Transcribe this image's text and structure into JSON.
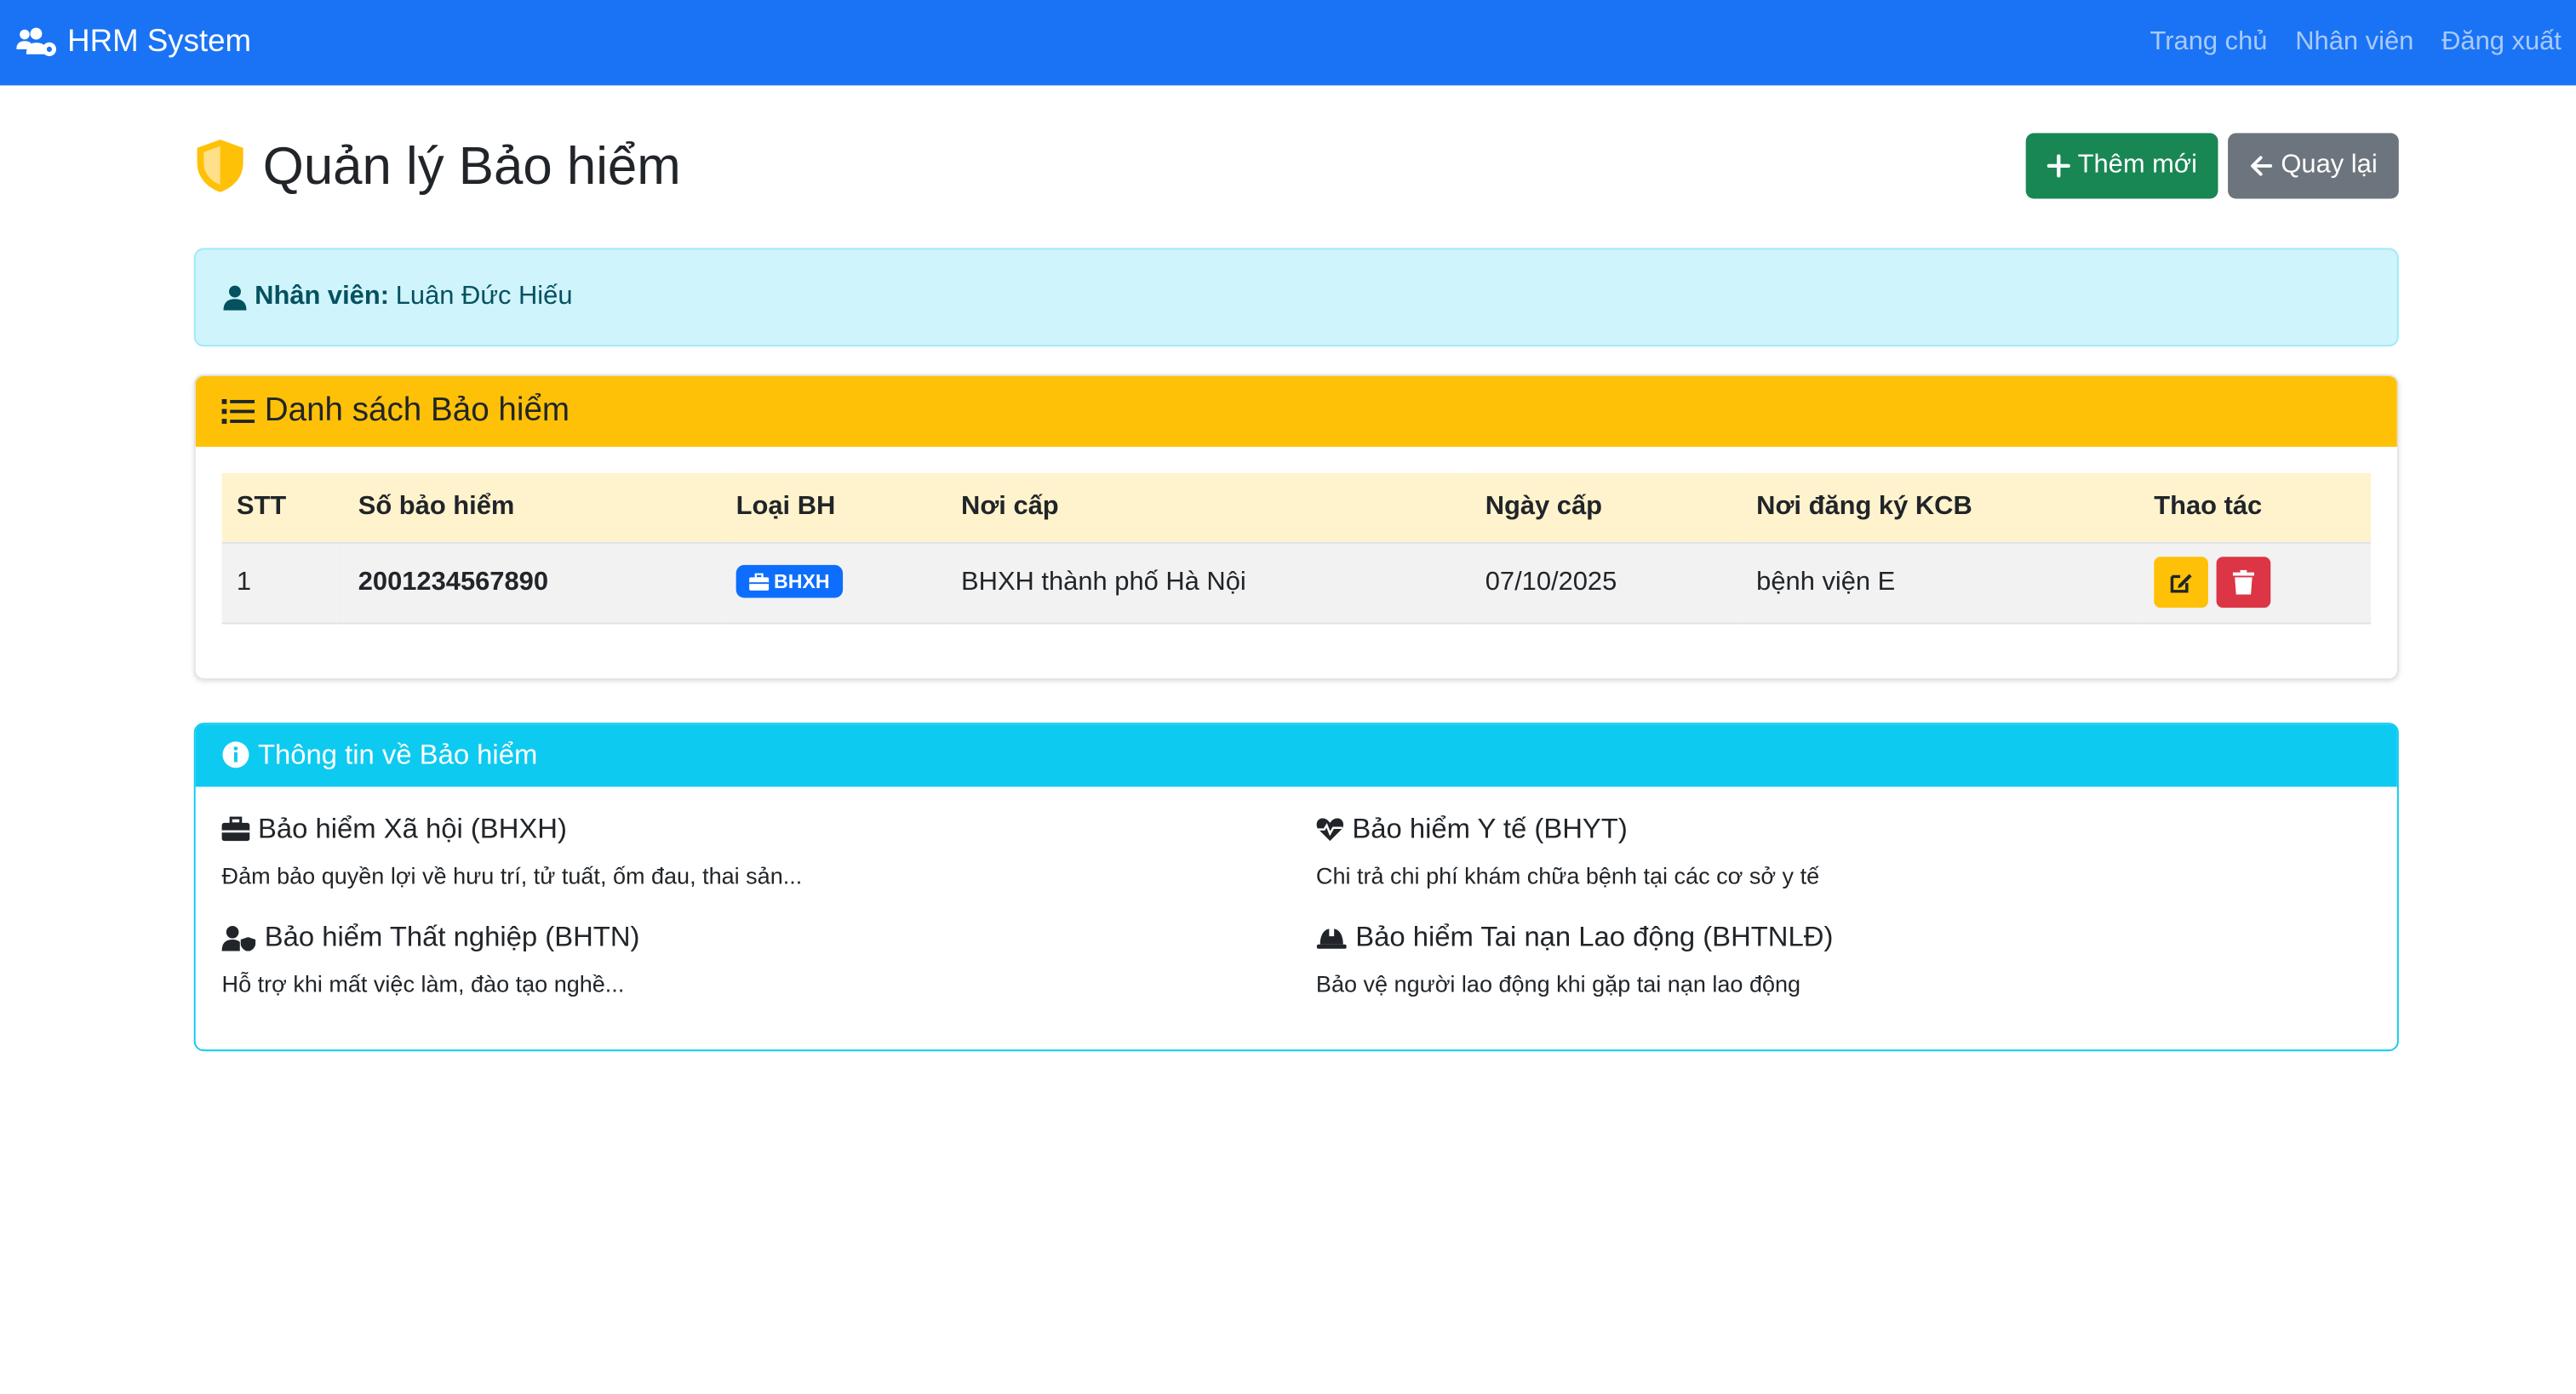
{
  "navbar": {
    "brand": "HRM System",
    "links": [
      "Trang chủ",
      "Nhân viên",
      "Đăng xuất"
    ]
  },
  "header": {
    "title": "Quản lý Bảo hiểm",
    "add_button": "Thêm mới",
    "back_button": "Quay lại"
  },
  "employee": {
    "label": "Nhân viên:",
    "name": "Luân Đức Hiếu"
  },
  "insurance_list": {
    "title": "Danh sách Bảo hiểm",
    "columns": [
      "STT",
      "Số bảo hiểm",
      "Loại BH",
      "Nơi cấp",
      "Ngày cấp",
      "Nơi đăng ký KCB",
      "Thao tác"
    ],
    "rows": [
      {
        "stt": "1",
        "number": "2001234567890",
        "type": "BHXH",
        "issued_by": "BHXH thành phố Hà Nội",
        "issued_date": "07/10/2025",
        "kcb": "bệnh viện E"
      }
    ]
  },
  "info": {
    "title": "Thông tin về Bảo hiểm",
    "items": [
      {
        "title": "Bảo hiểm Xã hội (BHXH)",
        "desc": "Đảm bảo quyền lợi về hưu trí, tử tuất, ốm đau, thai sản...",
        "icon": "briefcase-icon"
      },
      {
        "title": "Bảo hiểm Y tế (BHYT)",
        "desc": "Chi trả chi phí khám chữa bệnh tại các cơ sở y tế",
        "icon": "heartbeat-icon"
      },
      {
        "title": "Bảo hiểm Thất nghiệp (BHTN)",
        "desc": "Hỗ trợ khi mất việc làm, đào tạo nghề...",
        "icon": "user-shield-icon"
      },
      {
        "title": "Bảo hiểm Tai nạn Lao động (BHTNLĐ)",
        "desc": "Bảo vệ người lao động khi gặp tai nạn lao động",
        "icon": "hard-hat-icon"
      }
    ]
  },
  "colors": {
    "navbar": "#1a73f5",
    "success": "#198754",
    "secondary": "#6c757d",
    "warning": "#ffc107",
    "danger": "#dc3545",
    "info": "#0dcaf0",
    "primary": "#0d6efd"
  }
}
